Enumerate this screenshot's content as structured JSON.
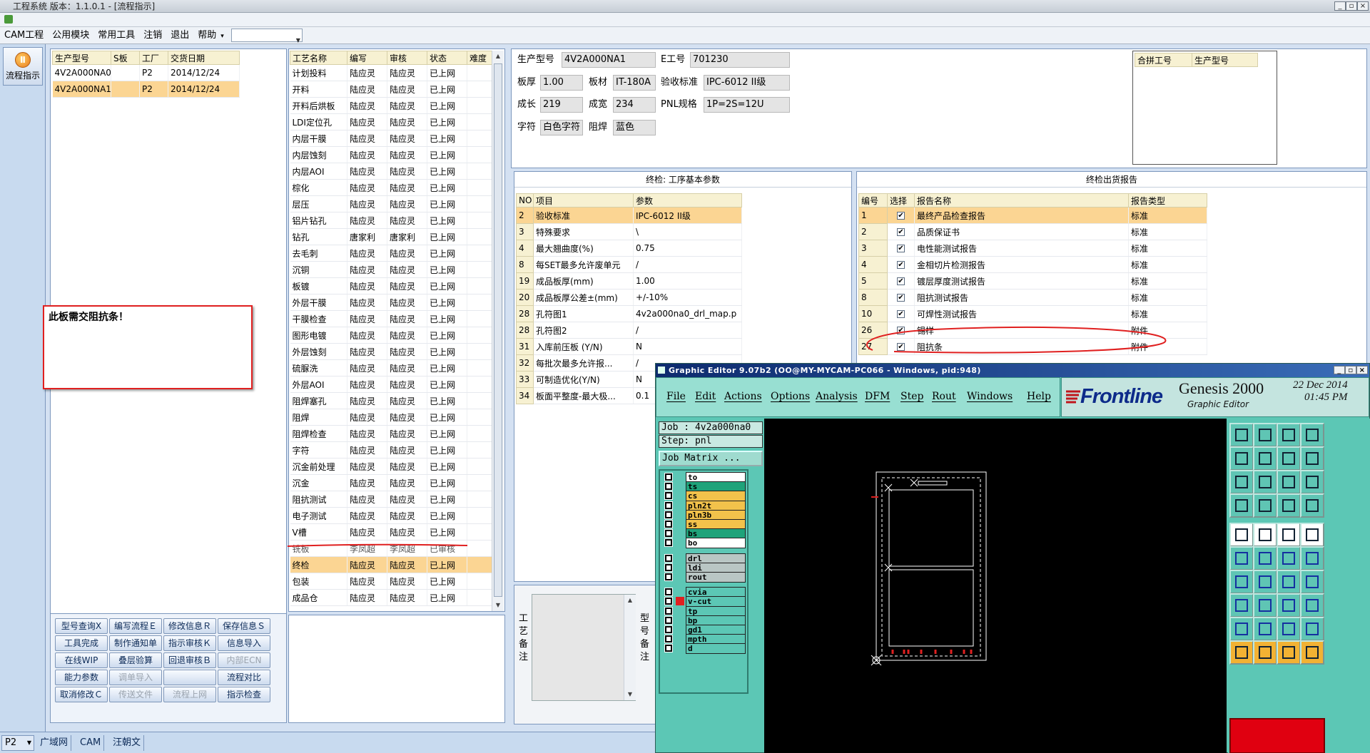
{
  "app": {
    "title": "工程系统  版本：1.1.0.1 - [流程指示]"
  },
  "menu": [
    "CAM工程",
    "公用模块",
    "常用工具",
    "注销",
    "退出",
    "帮助"
  ],
  "sidebar": {
    "flow_button": "流程指示"
  },
  "jobs": {
    "headers": [
      "生产型号",
      "S板",
      "工厂",
      "交货日期"
    ],
    "rows": [
      [
        "4V2A000NA0",
        "",
        "P2",
        "2014/12/24"
      ],
      [
        "4V2A000NA1",
        "",
        "P2",
        "2014/12/24"
      ]
    ]
  },
  "note": {
    "text": "此板需交阻抗条！"
  },
  "process": {
    "headers": [
      "工艺名称",
      "编写",
      "审核",
      "状态",
      "难度"
    ],
    "rows": [
      [
        "计划投料",
        "陆应灵",
        "陆应灵",
        "已上网",
        ""
      ],
      [
        "开料",
        "陆应灵",
        "陆应灵",
        "已上网",
        ""
      ],
      [
        "开料后烘板",
        "陆应灵",
        "陆应灵",
        "已上网",
        ""
      ],
      [
        "LDI定位孔",
        "陆应灵",
        "陆应灵",
        "已上网",
        ""
      ],
      [
        "内层干膜",
        "陆应灵",
        "陆应灵",
        "已上网",
        ""
      ],
      [
        "内层蚀刻",
        "陆应灵",
        "陆应灵",
        "已上网",
        ""
      ],
      [
        "内层AOI",
        "陆应灵",
        "陆应灵",
        "已上网",
        ""
      ],
      [
        "棕化",
        "陆应灵",
        "陆应灵",
        "已上网",
        ""
      ],
      [
        "层压",
        "陆应灵",
        "陆应灵",
        "已上网",
        ""
      ],
      [
        "铝片钻孔",
        "陆应灵",
        "陆应灵",
        "已上网",
        ""
      ],
      [
        "钻孔",
        "唐家利",
        "唐家利",
        "已上网",
        ""
      ],
      [
        "去毛刺",
        "陆应灵",
        "陆应灵",
        "已上网",
        ""
      ],
      [
        "沉铜",
        "陆应灵",
        "陆应灵",
        "已上网",
        ""
      ],
      [
        "板镀",
        "陆应灵",
        "陆应灵",
        "已上网",
        ""
      ],
      [
        "外层干膜",
        "陆应灵",
        "陆应灵",
        "已上网",
        ""
      ],
      [
        "干膜检查",
        "陆应灵",
        "陆应灵",
        "已上网",
        ""
      ],
      [
        "图形电镀",
        "陆应灵",
        "陆应灵",
        "已上网",
        ""
      ],
      [
        "外层蚀刻",
        "陆应灵",
        "陆应灵",
        "已上网",
        ""
      ],
      [
        "硫脲洗",
        "陆应灵",
        "陆应灵",
        "已上网",
        ""
      ],
      [
        "外层AOI",
        "陆应灵",
        "陆应灵",
        "已上网",
        ""
      ],
      [
        "阻焊塞孔",
        "陆应灵",
        "陆应灵",
        "已上网",
        ""
      ],
      [
        "阻焊",
        "陆应灵",
        "陆应灵",
        "已上网",
        ""
      ],
      [
        "阻焊检查",
        "陆应灵",
        "陆应灵",
        "已上网",
        ""
      ],
      [
        "字符",
        "陆应灵",
        "陆应灵",
        "已上网",
        ""
      ],
      [
        "沉金前处理",
        "陆应灵",
        "陆应灵",
        "已上网",
        ""
      ],
      [
        "沉金",
        "陆应灵",
        "陆应灵",
        "已上网",
        ""
      ],
      [
        "阻抗测试",
        "陆应灵",
        "陆应灵",
        "已上网",
        ""
      ],
      [
        "电子测试",
        "陆应灵",
        "陆应灵",
        "已上网",
        ""
      ],
      [
        "V槽",
        "陆应灵",
        "陆应灵",
        "已上网",
        ""
      ],
      [
        "铣板",
        "李凤超",
        "李凤超",
        "已审核",
        ""
      ],
      [
        "终检",
        "陆应灵",
        "陆应灵",
        "已上网",
        ""
      ],
      [
        "包装",
        "陆应灵",
        "陆应灵",
        "已上网",
        ""
      ],
      [
        "成品仓",
        "陆应灵",
        "陆应灵",
        "已上网",
        ""
      ]
    ]
  },
  "buttons": [
    [
      "型号查询Ⅹ",
      "编写流程Ｅ",
      "修改信息Ｒ",
      "保存信息Ｓ"
    ],
    [
      "工具完成",
      "制作通知单",
      "指示审核Ｋ",
      "信息导入"
    ],
    [
      "在线WIP",
      "叠层验算",
      "回退审核Ｂ",
      "内部ECN"
    ],
    [
      "能力参数",
      "调单导入",
      "",
      "流程对比"
    ],
    [
      "取消修改Ｃ",
      "传送文件",
      "流程上网",
      "指示检查"
    ]
  ],
  "info": {
    "model_label": "生产型号",
    "model": "4V2A000NA1",
    "eno_label": "E工号",
    "eno": "701230",
    "thick_label": "板厚",
    "thick": "1.00",
    "mat_label": "板材",
    "mat": "IT-180A",
    "std_label": "验收标准",
    "std": "IPC-6012 II级",
    "len_label": "成长",
    "len": "219",
    "wid_label": "成宽",
    "wid": "234",
    "pnl_label": "PNL规格",
    "pnl": "1P=2S=12U",
    "char_label": "字符",
    "char": "白色字符",
    "mask_label": "阻焊",
    "mask": "蓝色"
  },
  "merge": {
    "headers": [
      "合拼工号",
      "生产型号"
    ]
  },
  "params": {
    "title": "终检: 工序基本参数",
    "headers": [
      "NO",
      "项目",
      "参数"
    ],
    "rows": [
      [
        "2",
        "验收标准",
        "IPC-6012 II级"
      ],
      [
        "3",
        "特殊要求",
        "\\"
      ],
      [
        "4",
        "最大翘曲度(%)",
        "0.75"
      ],
      [
        "8",
        "每SET最多允许废单元",
        "/"
      ],
      [
        "19",
        "成品板厚(mm)",
        "1.00"
      ],
      [
        "20",
        "成品板厚公差±(mm)",
        "+/-10%"
      ],
      [
        "28",
        "孔符图1",
        "4v2a000na0_drl_map.p"
      ],
      [
        "28",
        "孔符图2",
        "/"
      ],
      [
        "31",
        "入库前压板 (Y/N)",
        "N"
      ],
      [
        "32",
        "每批次最多允许报...",
        "/"
      ],
      [
        "33",
        "可制造优化(Y/N)",
        "N"
      ],
      [
        "34",
        "板面平整度-最大极...",
        "0.1"
      ]
    ]
  },
  "reports": {
    "title": "终检出货报告",
    "headers": [
      "编号",
      "选择",
      "报告名称",
      "报告类型"
    ],
    "rows": [
      [
        "1",
        "✔",
        "最终产品检查报告",
        "标准"
      ],
      [
        "2",
        "✔",
        "品质保证书",
        "标准"
      ],
      [
        "3",
        "✔",
        "电性能测试报告",
        "标准"
      ],
      [
        "4",
        "✔",
        "金相切片检测报告",
        "标准"
      ],
      [
        "5",
        "✔",
        "镀层厚度测试报告",
        "标准"
      ],
      [
        "8",
        "✔",
        "阻抗测试报告",
        "标准"
      ],
      [
        "10",
        "✔",
        "可焊性测试报告",
        "标准"
      ],
      [
        "26",
        "✔",
        "锡样",
        "附件"
      ],
      [
        "27",
        "✔",
        "阻抗条",
        "附件"
      ]
    ]
  },
  "remarks": {
    "craft_label": "工艺备注",
    "model_label": "型号备注"
  },
  "status": {
    "combo": "P2",
    "tabs": [
      "广域网",
      "CAM",
      "汪朝文"
    ]
  },
  "genesis": {
    "title": "Graphic Editor 9.07b2 (OO@MY-MYCAM-PC066 - Windows, pid:948)",
    "menu": [
      "File",
      "Edit",
      "Actions",
      "Options",
      "Analysis",
      "DFM",
      "Step",
      "Rout",
      "Windows",
      "Help"
    ],
    "brand": "Frontline",
    "product": "Genesis 2000",
    "subtitle": "Graphic Editor",
    "date": "22 Dec 2014",
    "time": "01:45 PM",
    "job": "Job : 4v2a000na0",
    "step": "Step: pnl",
    "job_matrix": "Job Matrix ...",
    "layers": [
      {
        "name": "to",
        "color": "#ffffff"
      },
      {
        "name": "ts",
        "color": "#1fa37a"
      },
      {
        "name": "cs",
        "color": "#f2c24b"
      },
      {
        "name": "pln2t",
        "color": "#f2c24b"
      },
      {
        "name": "pln3b",
        "color": "#f2c24b"
      },
      {
        "name": "ss",
        "color": "#f2c24b"
      },
      {
        "name": "bs",
        "color": "#1fa37a"
      },
      {
        "name": "bo",
        "color": "#ffffff"
      },
      {
        "name": "drl",
        "color": "#b9c6c4"
      },
      {
        "name": "ldi",
        "color": "#b9c6c4"
      },
      {
        "name": "rout",
        "color": "#b9c6c4"
      },
      {
        "name": "cvia",
        "color": "#5cc7b5"
      },
      {
        "name": "v-cut",
        "color": "#5cc7b5"
      },
      {
        "name": "tp",
        "color": "#5cc7b5"
      },
      {
        "name": "bp",
        "color": "#5cc7b5"
      },
      {
        "name": "gd1",
        "color": "#5cc7b5"
      },
      {
        "name": "mpth",
        "color": "#5cc7b5"
      },
      {
        "name": "d",
        "color": "#5cc7b5"
      }
    ]
  }
}
